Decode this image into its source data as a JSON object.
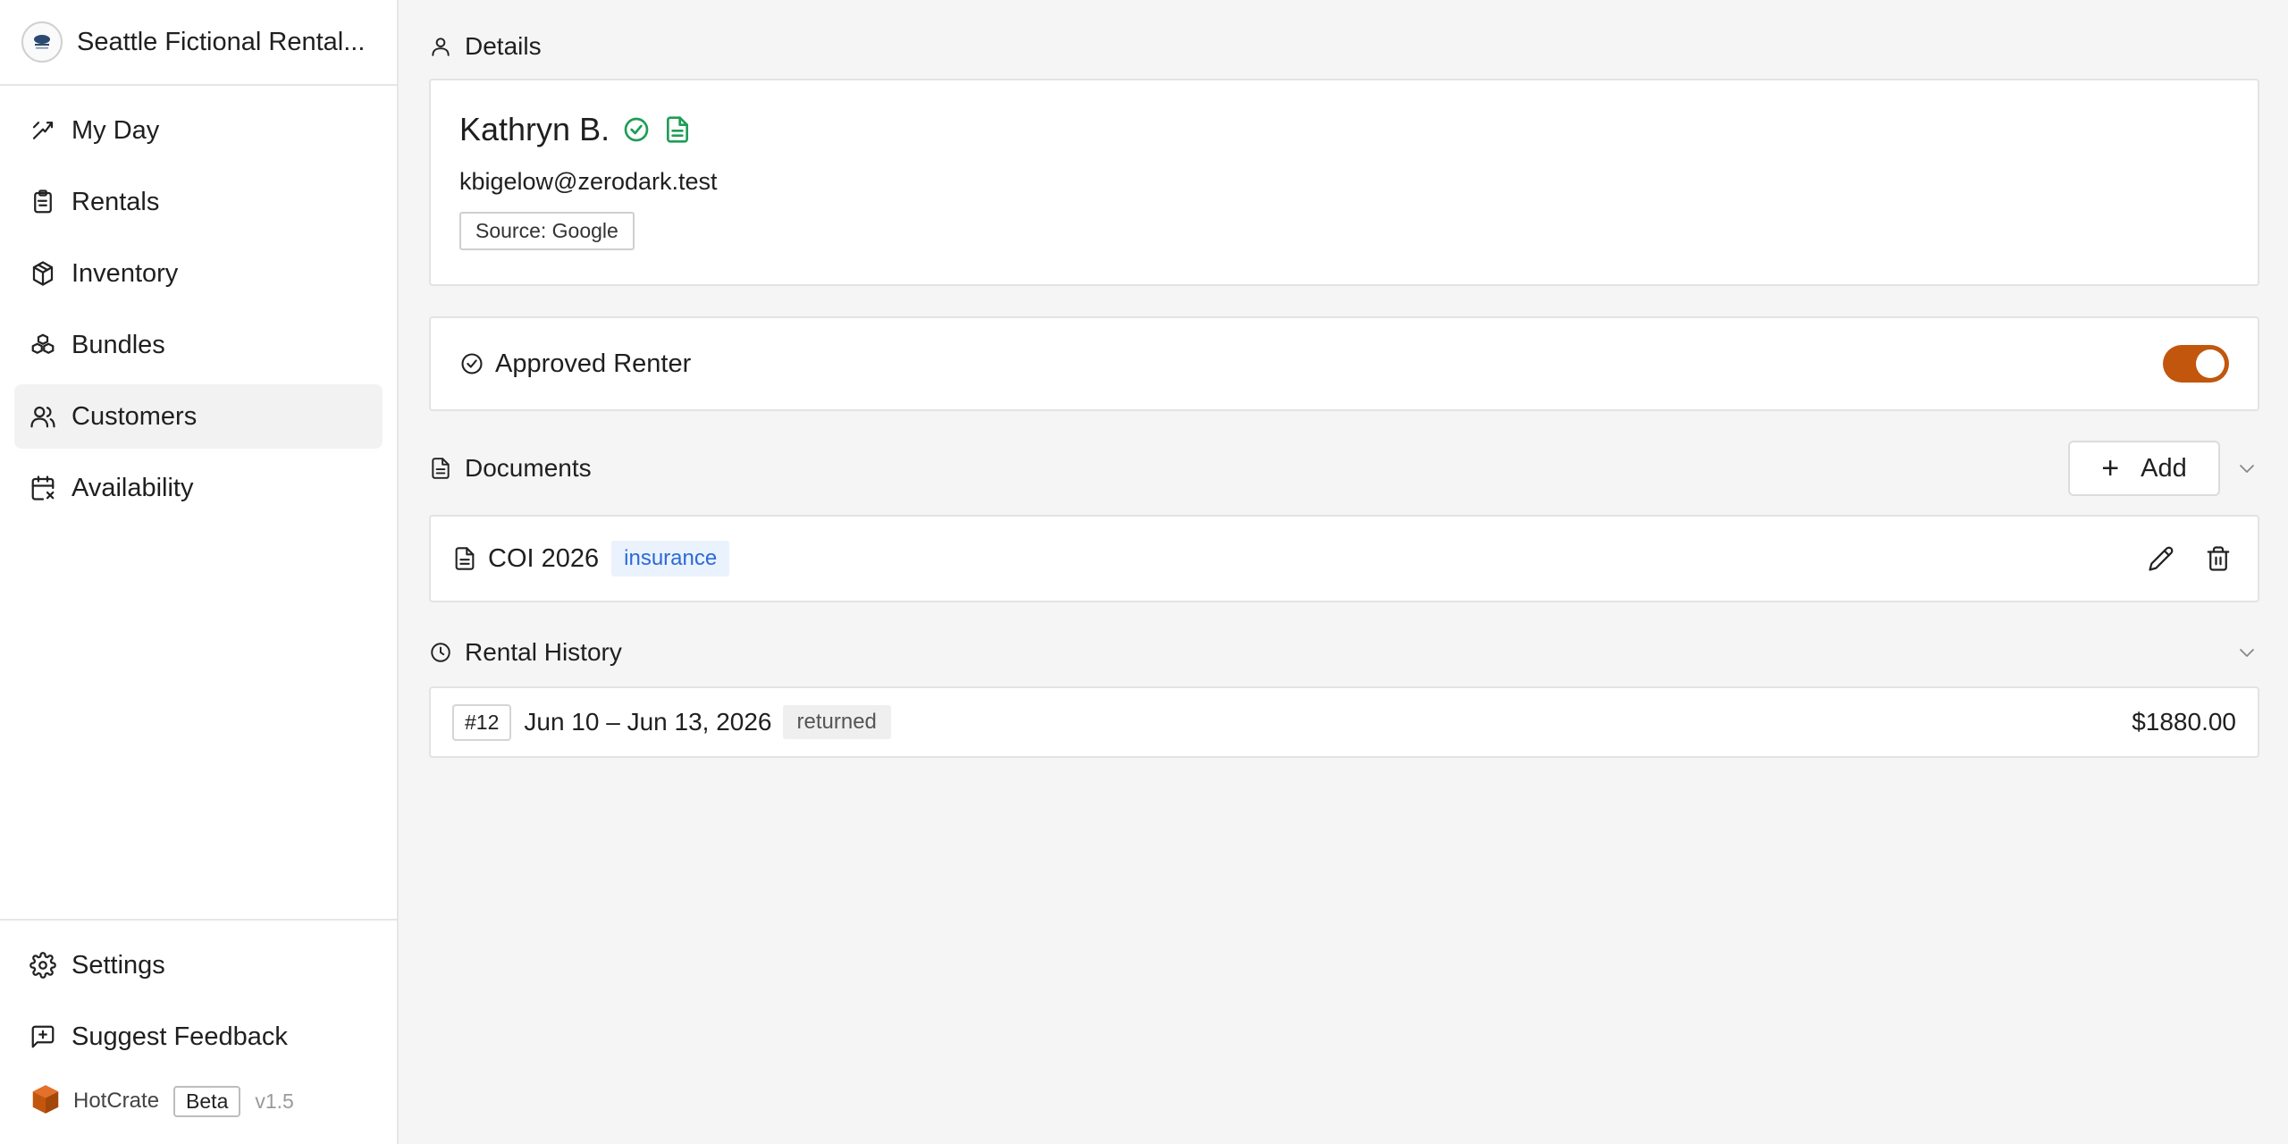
{
  "brand": {
    "name": "Seattle Fictional Rental..."
  },
  "sidebar": {
    "items": [
      {
        "label": "My Day",
        "icon": "trend-icon",
        "active": false
      },
      {
        "label": "Rentals",
        "icon": "clipboard-icon",
        "active": false
      },
      {
        "label": "Inventory",
        "icon": "package-icon",
        "active": false
      },
      {
        "label": "Bundles",
        "icon": "bundles-icon",
        "active": false
      },
      {
        "label": "Customers",
        "icon": "users-icon",
        "active": true
      },
      {
        "label": "Availability",
        "icon": "calendar-x-icon",
        "active": false
      }
    ],
    "bottom": [
      {
        "label": "Settings",
        "icon": "gear-icon"
      },
      {
        "label": "Suggest Feedback",
        "icon": "feedback-icon"
      }
    ],
    "footer": {
      "app_name": "HotCrate",
      "badge": "Beta",
      "version": "v1.5"
    }
  },
  "details": {
    "header": "Details",
    "name": "Kathryn B.",
    "email": "kbigelow@zerodark.test",
    "source": "Source: Google"
  },
  "approved": {
    "label": "Approved Renter",
    "enabled": true
  },
  "documents": {
    "header": "Documents",
    "add_label": "Add",
    "items": [
      {
        "title": "COI 2026",
        "tag": "insurance"
      }
    ]
  },
  "rental_history": {
    "header": "Rental History",
    "items": [
      {
        "order": "#12",
        "dates": "Jun 10 – Jun 13, 2026",
        "status": "returned",
        "amount": "$1880.00"
      }
    ]
  },
  "colors": {
    "accent": "#c2560d",
    "success": "#1f9d55",
    "tag_blue_bg": "#eaf2fd",
    "tag_blue_text": "#2c6ad6"
  }
}
